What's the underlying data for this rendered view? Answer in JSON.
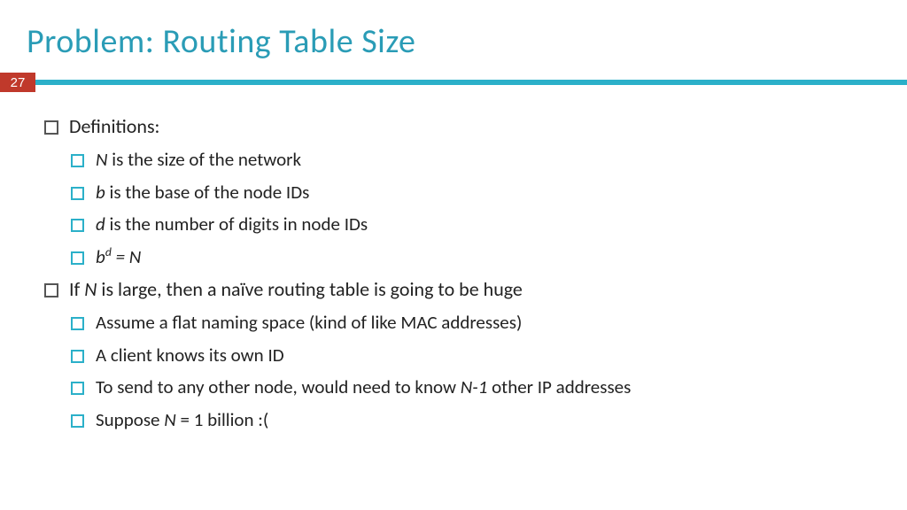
{
  "title": "Problem: Routing Table Size",
  "slide_number": "27",
  "bullets": {
    "b1": "Definitions:",
    "b1_1_pre": "N",
    "b1_1_post": " is the size of the network",
    "b1_2_pre": "b",
    "b1_2_post": " is the base of the node IDs",
    "b1_3_pre": "d",
    "b1_3_post": " is the number of digits in node IDs",
    "b1_4_base": "b",
    "b1_4_exp": "d",
    "b1_4_post": " = N",
    "b2_pre": "If ",
    "b2_mid": "N",
    "b2_post": " is large, then a naïve routing table is going to be huge",
    "b2_1": "Assume a flat naming space (kind of like MAC addresses)",
    "b2_2": "A client knows its own ID",
    "b2_3_pre": "To send to any other node, would need to know ",
    "b2_3_mid": "N-1",
    "b2_3_post": " other IP addresses",
    "b2_4_pre": "Suppose ",
    "b2_4_mid": "N",
    "b2_4_post": " = 1 billion :("
  }
}
